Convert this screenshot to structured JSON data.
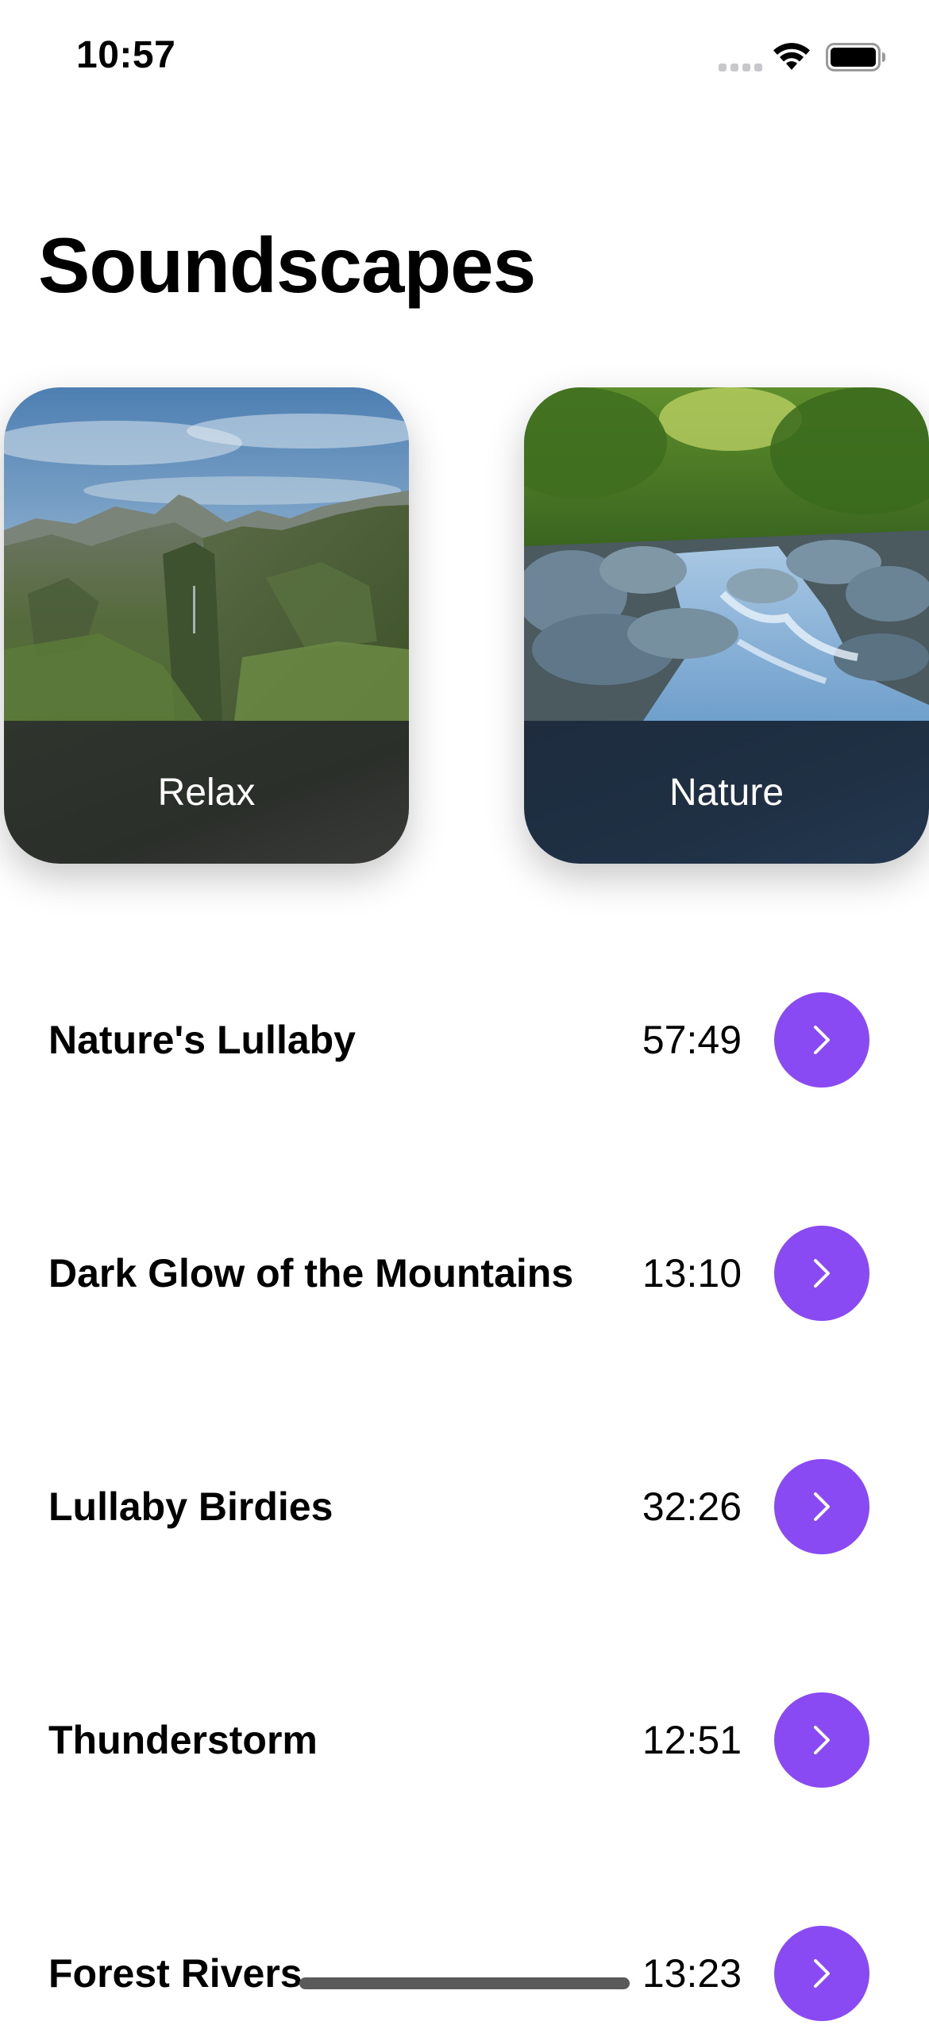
{
  "status_bar": {
    "time": "10:57",
    "icons": [
      "cellular-signal-icon",
      "wifi-icon",
      "battery-icon"
    ]
  },
  "title": "Soundscapes",
  "categories": [
    {
      "label": "Relax",
      "image": "mountain-canyon-photo",
      "footer_color": "#2d312c"
    },
    {
      "label": "Nature",
      "image": "forest-river-photo",
      "footer_color": "#1f2f43"
    }
  ],
  "tracks": [
    {
      "title": "Nature's Lullaby",
      "duration": "57:49"
    },
    {
      "title": "Dark Glow of the Mountains",
      "duration": "13:10"
    },
    {
      "title": "Lullaby Birdies",
      "duration": "32:26"
    },
    {
      "title": "Thunderstorm",
      "duration": "12:51"
    },
    {
      "title": "Forest Rivers",
      "duration": "13:23"
    }
  ],
  "colors": {
    "accent": "#8a4af3",
    "text": "#000000",
    "background": "#ffffff"
  },
  "icons": {
    "track_button": "chevron-right-icon"
  }
}
